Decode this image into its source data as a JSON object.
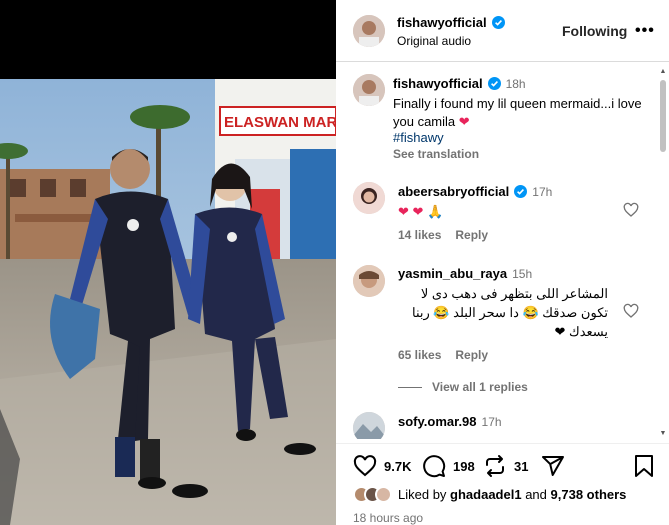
{
  "post": {
    "username": "fishawyofficial",
    "audio": "Original audio",
    "following_label": "Following",
    "more_label": "•••"
  },
  "caption": {
    "username": "fishawyofficial",
    "time": "18h",
    "text": "Finally i found my lil queen mermaid...i love you camila",
    "emoji": "❤",
    "hashtag": "#fishawy",
    "see_translation": "See translation"
  },
  "photo": {
    "signs": [
      "ELASWAN MARKE"
    ]
  },
  "comments": [
    {
      "username": "abeersabryofficial",
      "verified": true,
      "time": "17h",
      "text": "❤ ❤ 🙏",
      "likes": "14 likes",
      "reply": "Reply"
    },
    {
      "username": "yasmin_abu_raya",
      "verified": false,
      "time": "15h",
      "text_lines": [
        "المشاعر اللى بتظهر فى دهب دى لا",
        "تكون صدقك 😂 دا سحر البلد 😂 ربنا",
        "يسعدك ❤"
      ],
      "likes": "65 likes",
      "reply": "Reply",
      "view_replies": "View all 1 replies"
    },
    {
      "username": "sofy.omar.98",
      "verified": false,
      "time": "17h"
    }
  ],
  "actions": {
    "likes_count": "9.7K",
    "comments_count": "198",
    "reposts_count": "31",
    "liked_by_prefix": "Liked by",
    "liked_by_user": "ghadaadel1",
    "liked_by_and": "and",
    "liked_by_others": "9,738 others",
    "posted_ago": "18 hours ago"
  },
  "colors": {
    "accent": "#0095f6",
    "heart": "#e8245b",
    "muted": "#737373"
  }
}
